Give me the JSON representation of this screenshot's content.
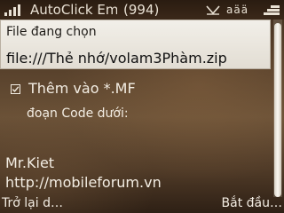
{
  "status_bar": {
    "app_title": "AutoClick Emb",
    "message_count": "(994)",
    "network_label": "aää"
  },
  "file_section": {
    "label": "File đang chọn",
    "path": "file:///Thẻ nhớ/volam3Phàm.zip"
  },
  "options": {
    "checkbox_label": "Thêm vào *.MF",
    "checked": true,
    "code_label": "đoạn Code dưới:"
  },
  "footer_info": {
    "author": "Mr.Kiet",
    "website": "http://mobileforum.vn"
  },
  "softkeys": {
    "left": "Trở lại d…",
    "right": "Bắt đầu…"
  },
  "colors": {
    "text_light": "#f3ede3",
    "field_bg": "#f2efe9",
    "background_mid": "#6a5137"
  }
}
